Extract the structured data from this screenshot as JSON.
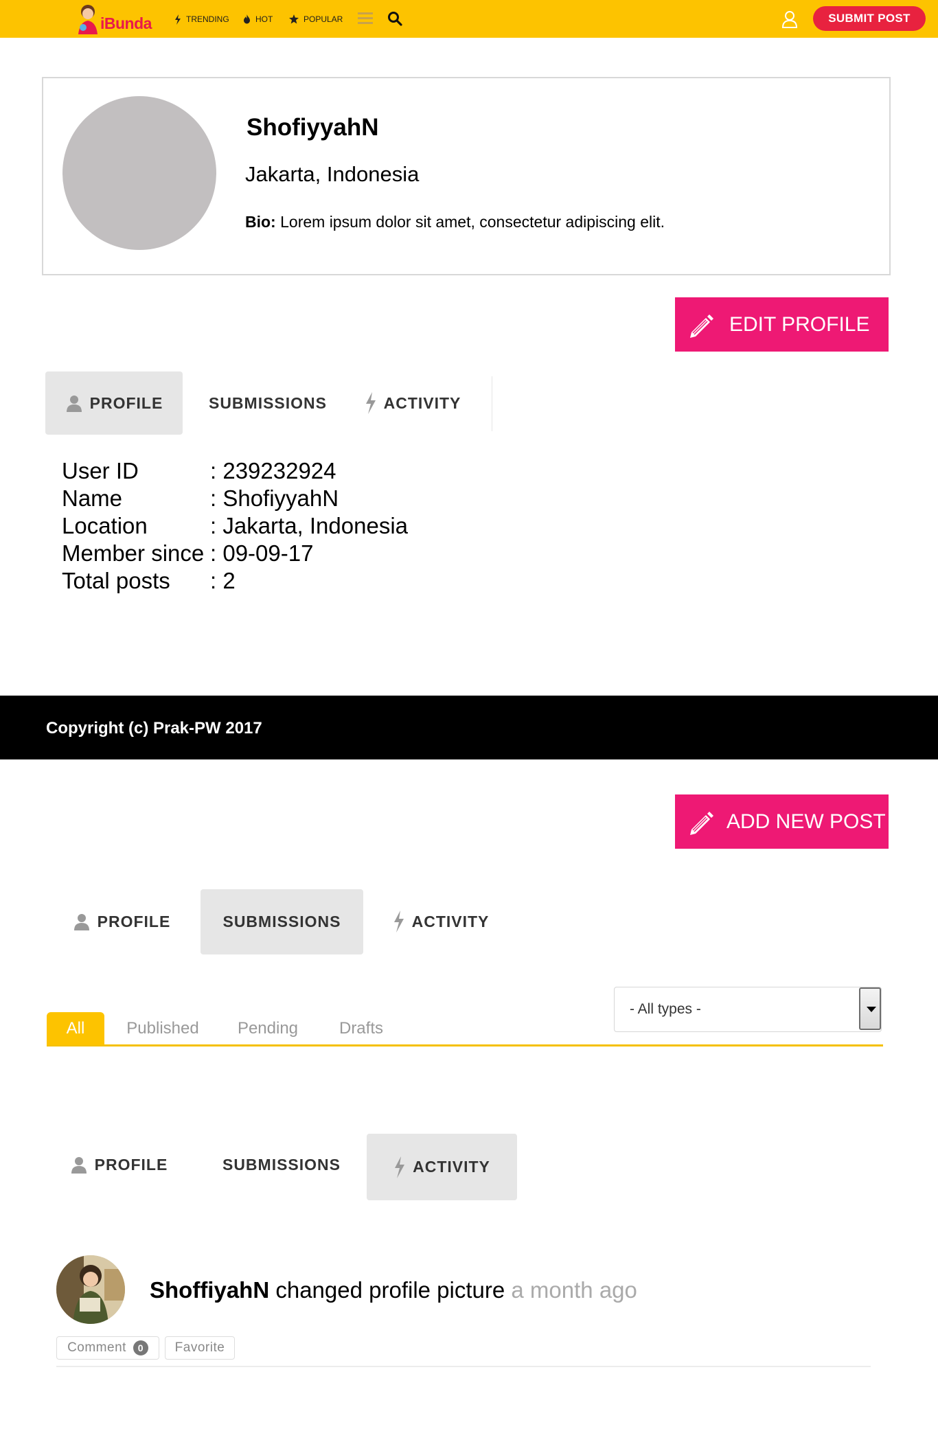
{
  "topbar": {
    "brand": "iBunda",
    "nav": [
      {
        "label": "TRENDING",
        "icon": "bolt-icon"
      },
      {
        "label": "HOT",
        "icon": "fire-icon"
      },
      {
        "label": "POPULAR",
        "icon": "star-icon"
      }
    ],
    "submit_label": "SUBMIT POST",
    "colors": {
      "bar": "#fdc300",
      "submit": "#e8223f"
    }
  },
  "profile_card": {
    "name": "ShofiyyahN",
    "location": "Jakarta, Indonesia",
    "bio_label": "Bio:",
    "bio_text": " Lorem ipsum dolor sit amet, consectetur adipiscing elit."
  },
  "edit_profile_label": "EDIT PROFILE",
  "add_new_post_label": "ADD NEW POST",
  "tabs": {
    "profile": "PROFILE",
    "submissions": "SUBMISSIONS",
    "activity": "ACTIVITY"
  },
  "info": [
    {
      "key": "User ID",
      "value": ": 239232924"
    },
    {
      "key": "Name",
      "value": ": ShofiyyahN"
    },
    {
      "key": "Location",
      "value": ": Jakarta, Indonesia"
    },
    {
      "key": "Member since",
      "value": ": 09-09-17"
    },
    {
      "key": "Total posts",
      "value": ": 2"
    }
  ],
  "footer": {
    "text": "Copyright (c) Prak-PW 2017"
  },
  "submissions": {
    "filters": [
      "All",
      "Published",
      "Pending",
      "Drafts"
    ],
    "active_filter": "All",
    "type_select": "- All types -"
  },
  "activity": {
    "user": "ShoffiyahN",
    "action": " changed profile picture ",
    "time": "a month ago",
    "comment_label": "Comment",
    "comment_count": "0",
    "favorite_label": "Favorite"
  },
  "accent_pink": "#ee1974"
}
